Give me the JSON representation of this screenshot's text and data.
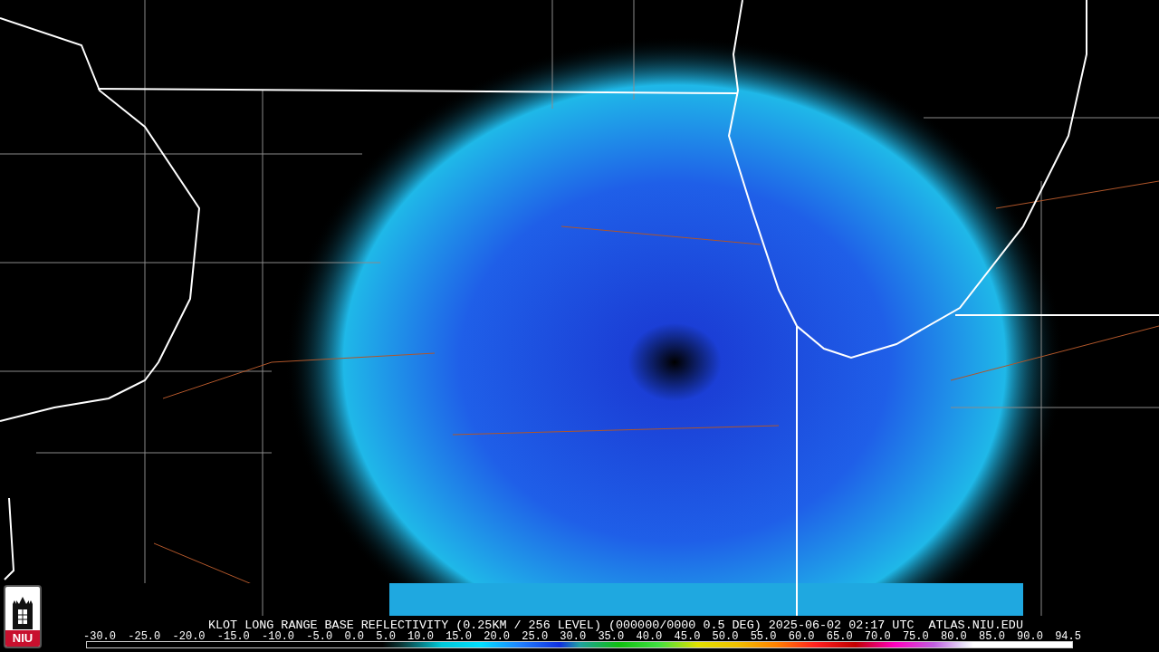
{
  "logo": {
    "text": "NIU"
  },
  "caption": {
    "title": "KLOT LONG RANGE BASE REFLECTIVITY (0.25KM / 256 LEVEL) (000000/0000 0.5 DEG) 2025-06-02 02:17 UTC",
    "source": "ATLAS.NIU.EDU"
  },
  "scale_labels": [
    "-30.0",
    "-25.0",
    "-20.0",
    "-15.0",
    "-10.0",
    "-5.0",
    "0.0",
    "5.0",
    "10.0",
    "15.0",
    "20.0",
    "25.0",
    "30.0",
    "35.0",
    "40.0",
    "45.0",
    "50.0",
    "55.0",
    "60.0",
    "65.0",
    "70.0",
    "75.0",
    "80.0",
    "85.0",
    "90.0",
    "94.5"
  ]
}
